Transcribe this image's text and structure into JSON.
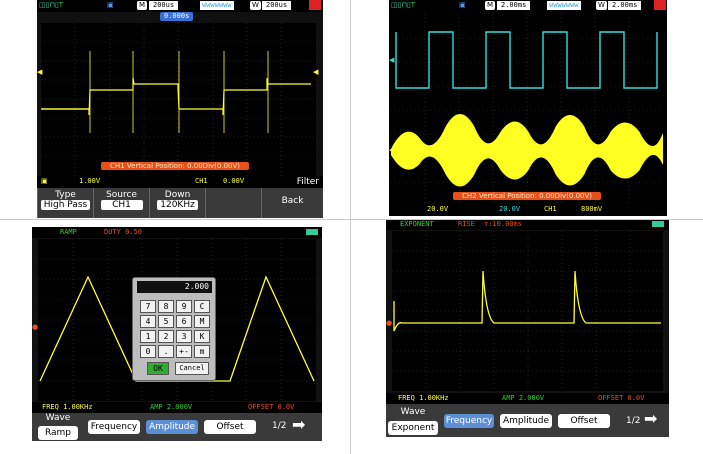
{
  "panel_top_left": {
    "topbar": {
      "m_label": "M",
      "time_div": "200us",
      "wave_icon": "wwwwwww",
      "w_label": "W",
      "window_div": "200us",
      "trigger_pos": "0.000s"
    },
    "status": {
      "ch_volt": "1.00V",
      "trig_ch": "CH1",
      "trig_level": "0.00V"
    },
    "orange_msg": "CH1 Vertical Position: 0.00Div(0.00V)",
    "menu": [
      {
        "title": "Type",
        "value": "High Pass"
      },
      {
        "title": "Source",
        "value": "CH1"
      },
      {
        "title": "Down",
        "value": "120KHz"
      },
      {
        "title": "",
        "value": ""
      },
      {
        "title": "Filter",
        "value": "Back"
      }
    ]
  },
  "panel_top_right": {
    "topbar": {
      "m_label": "M",
      "time_div": "2.00ms",
      "wave_icon": "wwwwwww",
      "w_label": "W",
      "window_div": "2.00ms"
    },
    "orange_msg": "CH2 Vertical Position: 0.00Div(0.00V)",
    "status": {
      "ch1_volt": "20.0V",
      "ch2_volt": "20.0V",
      "trig_ch": "CH1",
      "trig_level": "800mV"
    }
  },
  "panel_bottom_left": {
    "header": {
      "wave_name": "RAMP",
      "param": "DUTY 0.50"
    },
    "keypad": {
      "display": "2.000",
      "keys": [
        "7",
        "8",
        "9",
        "C",
        "4",
        "5",
        "6",
        "M",
        "1",
        "2",
        "3",
        "K",
        "0",
        ".",
        "+-",
        "m"
      ],
      "ok": "OK",
      "cancel": "Cancel"
    },
    "footer": {
      "freq": "FREQ 1.00KHz",
      "amp": "AMP 2.000V",
      "offset": "OFFSET 0.0V"
    },
    "menu": {
      "wave_title": "Wave",
      "wave_value": "Ramp",
      "frequency": "Frequency",
      "amplitude": "Amplitude",
      "offset": "Offset",
      "page": "1/2"
    }
  },
  "panel_bottom_right": {
    "header": {
      "wave_name": "EXPONENT",
      "param": "RISE",
      "tau": "τ:10.00ms"
    },
    "footer": {
      "freq": "FREQ 1.00KHz",
      "amp": "AMP 2.000V",
      "offset": "OFFSET 0.0V"
    },
    "menu": {
      "wave_title": "Wave",
      "wave_value": "Exponent",
      "frequency": "Frequency",
      "amplitude": "Amplitude",
      "offset": "Offset",
      "page": "1/2"
    }
  },
  "colors": {
    "ch1": "#ffff33",
    "ch2": "#33dddd",
    "grid": "#555555",
    "menu_bg": "#3a3a3a",
    "orange": "#e8501a",
    "green": "#33cc33",
    "selected_blue": "#5c8fd6"
  }
}
